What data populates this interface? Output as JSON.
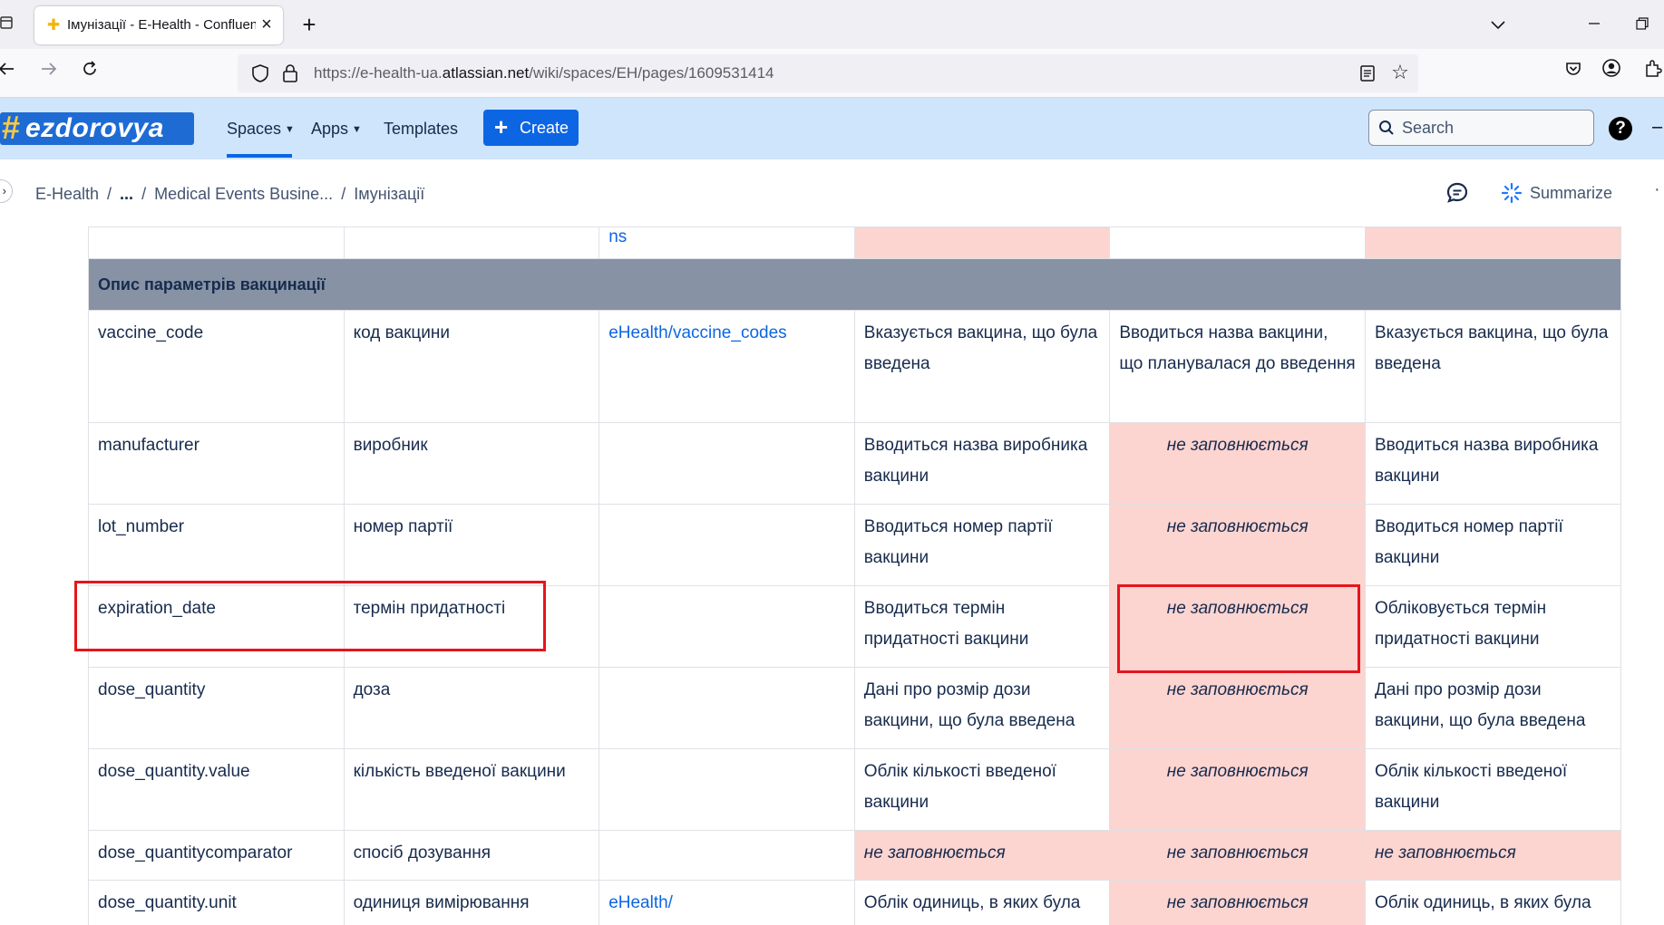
{
  "browser": {
    "tab_title": "Імунізації - E-Health - Confluence",
    "favicon": "✚",
    "new_tab": "+",
    "url_prefix": "https://e-health-ua.",
    "url_domain": "atlassian.net",
    "url_path": "/wiki/spaces/EH/pages/1609531414"
  },
  "header": {
    "logo_hash": "#",
    "logo_text": "ezdorovya",
    "nav": {
      "spaces": "Spaces",
      "apps": "Apps",
      "templates": "Templates"
    },
    "create_label": "Create",
    "search_placeholder": "Search",
    "help": "?"
  },
  "breadcrumb": {
    "items": [
      "E-Health",
      "...",
      "Medical Events Busine...",
      "Імунізації"
    ],
    "separator": "/",
    "summarize": "Summarize"
  },
  "table": {
    "top_row": {
      "col3": "ns"
    },
    "section_title": "Опис параметрів вакцинації",
    "rows": [
      {
        "param": "vaccine_code",
        "desc": "код вакцини",
        "dict": "eHealth/vaccine_codes",
        "c4": "Вказується вакцина, що була введена",
        "c5": "Вводиться назва вакцини, що планувалася до введення",
        "c6": "Вказується вакцина, що була введена"
      },
      {
        "param": "manufacturer",
        "desc": "виробник",
        "dict": "",
        "c4": "Вводиться назва виробника вакцини",
        "c5": "не заповнюється",
        "c6": "Вводиться назва виробника вакцини"
      },
      {
        "param": "lot_number",
        "desc": "номер партії",
        "dict": "",
        "c4": "Вводиться номер партії вакцини",
        "c5": "не заповнюється",
        "c6": "Вводиться номер партії вакцини"
      },
      {
        "param": "expiration_date",
        "desc": "термін придатності",
        "dict": "",
        "c4": "Вводиться термін придатності вакцини",
        "c5": "не заповнюється",
        "c6": "Обліковується термін придатності вакцини"
      },
      {
        "param": "dose_quantity",
        "desc": "доза",
        "dict": "",
        "c4": "Дані про розмір дози вакцини, що була введена",
        "c5": "не заповнюється",
        "c6": "Дані про розмір дози вакцини, що була введена"
      },
      {
        "param": "dose_quantity.value",
        "desc": "кількість введеної вакцини",
        "dict": "",
        "c4": "Облік кількості введеної вакцини",
        "c5": "не заповнюється",
        "c6": "Облік кількості введеної вакцини"
      },
      {
        "param": "dose_quantitycomparator",
        "desc": "спосіб дозування",
        "dict": "",
        "c4": "не заповнюється",
        "c5": "не заповнюється",
        "c6": "не заповнюється"
      },
      {
        "param": "dose_quantity.unit",
        "desc": "одиниця вимірювання",
        "dict": "eHealth/",
        "c4": "Облік одиниць, в яких була",
        "c5": "не заповнюється",
        "c6": "Облік одиниць, в яких була"
      }
    ]
  },
  "colors": {
    "header_bg": "#cfe5fb",
    "accent": "#0c66e4",
    "pink_cell": "#fcd4d0",
    "section_bg": "#8793a5",
    "highlight": "#e8141c"
  }
}
